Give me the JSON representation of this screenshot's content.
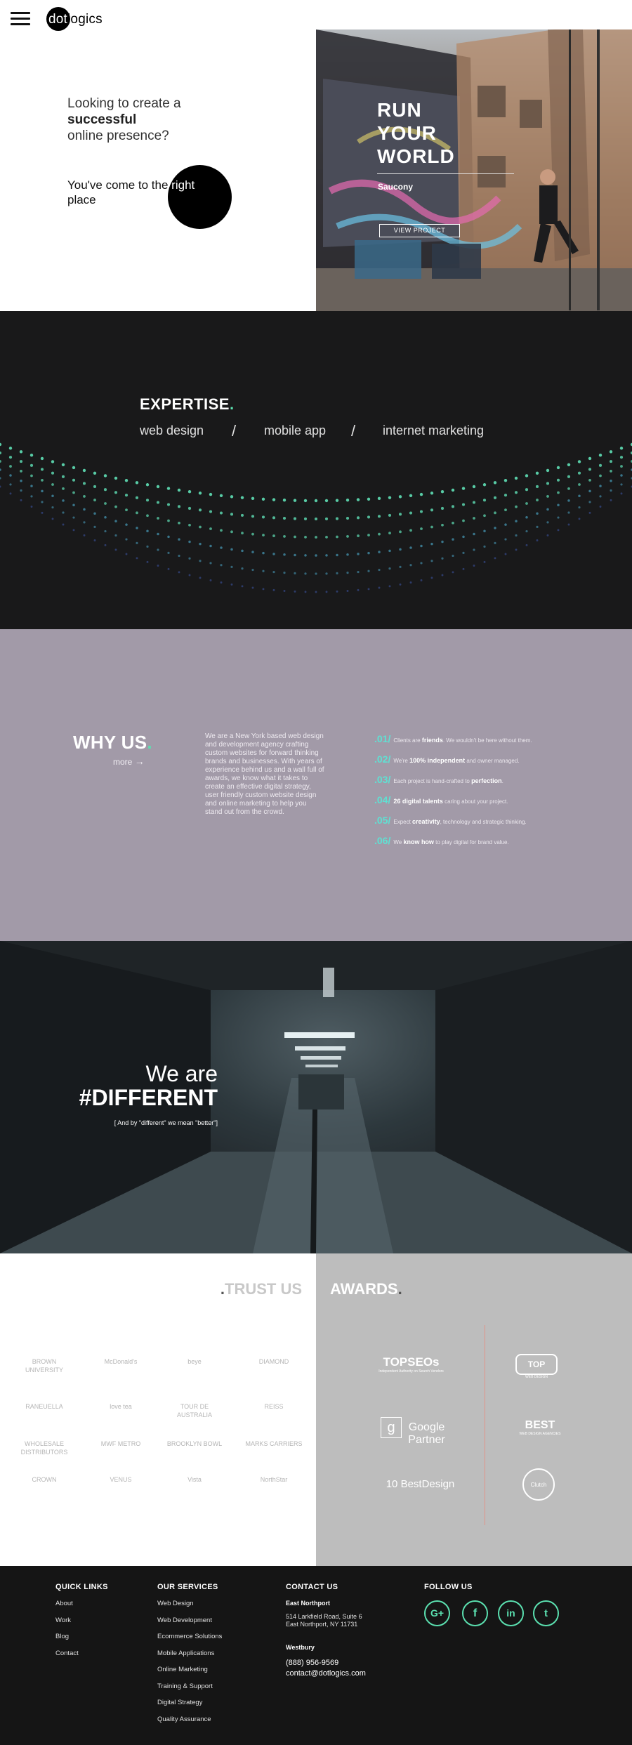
{
  "header": {
    "logo_left": "dot",
    "logo_right": "logics"
  },
  "hero": {
    "line1": "Looking to create a",
    "line2": "successful",
    "line3": "online presence?",
    "sub_dark": "You've come to the ",
    "sub_light": "right",
    "sub_last": "place",
    "feature": {
      "title_1": "RUN",
      "title_2": "YOUR",
      "title_3": "WORLD",
      "brand": "Saucony",
      "button": "VIEW PROJECT"
    }
  },
  "expertise": {
    "title": "EXPERTISE",
    "dot": ".",
    "links": [
      "web design",
      "mobile app",
      "internet marketing"
    ],
    "separator": "/",
    "accent_color": "#5be0b0"
  },
  "why_us": {
    "title": "WHY US",
    "dot": ".",
    "more": "more",
    "body": "We are a New York based web design and development agency crafting custom websites for forward thinking brands and businesses. With years of experience behind us and a wall full of awards, we know what it takes to create an effective digital strategy, user friendly custom website design and online marketing to help you stand out from the crowd.",
    "items": [
      {
        "num": ".01/",
        "pre": "Clients are ",
        "bold": "friends",
        "post": ". We wouldn't be here without them."
      },
      {
        "num": ".02/",
        "pre": "We're ",
        "bold": "100% independent",
        "post": " and owner managed."
      },
      {
        "num": ".03/",
        "pre": "Each project is hand-crafted to ",
        "bold": "perfection",
        "post": "."
      },
      {
        "num": ".04/",
        "pre": "",
        "bold": "26 digital talents",
        "post": " caring about your project."
      },
      {
        "num": ".05/",
        "pre": "Expect ",
        "bold": "creativity",
        "post": ", technology and strategic thinking."
      },
      {
        "num": ".06/",
        "pre": "We ",
        "bold": "know how",
        "post": " to play digital for brand value."
      }
    ]
  },
  "different": {
    "line1": "We are",
    "line2": "#DIFFERENT",
    "sub": "[ And by \"different\" we mean \"better\"]"
  },
  "trust": {
    "dot": ".",
    "title": "TRUST US",
    "clients": [
      "BROWN UNIVERSITY",
      "McDonald's",
      "beye",
      "DIAMOND",
      "RANEUELLA",
      "love tea",
      "TOUR DE AUSTRALIA",
      "REISS",
      "WHOLESALE DISTRIBUTORS",
      "MWF METRO",
      "BROOKLYN BOWL",
      "MARKS CARRIERS",
      "CROWN",
      "VENUS",
      "Vista",
      "NorthStar"
    ]
  },
  "awards": {
    "title": "AWARDS",
    "dot": ".",
    "left": [
      "TOPSEOs",
      "Google Partner",
      "10 BestDesign"
    ],
    "left_subs": [
      "Independent Authority on Search Vendors",
      "",
      ""
    ],
    "right": [
      "TOP",
      "BEST",
      "Clutch"
    ],
    "right_subs": [
      "WEB DESIGN",
      "WEB DESIGN AGENCIES",
      ""
    ]
  },
  "footer": {
    "quick_links": {
      "title": "QUICK LINKS",
      "items": [
        "About",
        "Work",
        "Blog",
        "Contact"
      ]
    },
    "services": {
      "title": "OUR SERVICES",
      "items": [
        "Web Design",
        "Web Development",
        "Ecommerce Solutions",
        "Mobile Applications",
        "Online Marketing",
        "Training & Support",
        "Digital Strategy",
        "Quality Assurance"
      ]
    },
    "contact": {
      "title": "CONTACT US",
      "office1": "East Northport",
      "addr1": "514 Larkfield Road, Suite 6",
      "addr2": "East Northport, NY 11731",
      "office2": "Westbury",
      "phone": "(888) 956-9569",
      "email": "contact@dotlogics.com"
    },
    "follow": {
      "title": "FOLLOW US",
      "icons": [
        "google-plus-icon",
        "facebook-icon",
        "linkedin-icon",
        "twitter-icon"
      ],
      "labels": [
        "G+",
        "f",
        "in",
        "t"
      ]
    }
  }
}
